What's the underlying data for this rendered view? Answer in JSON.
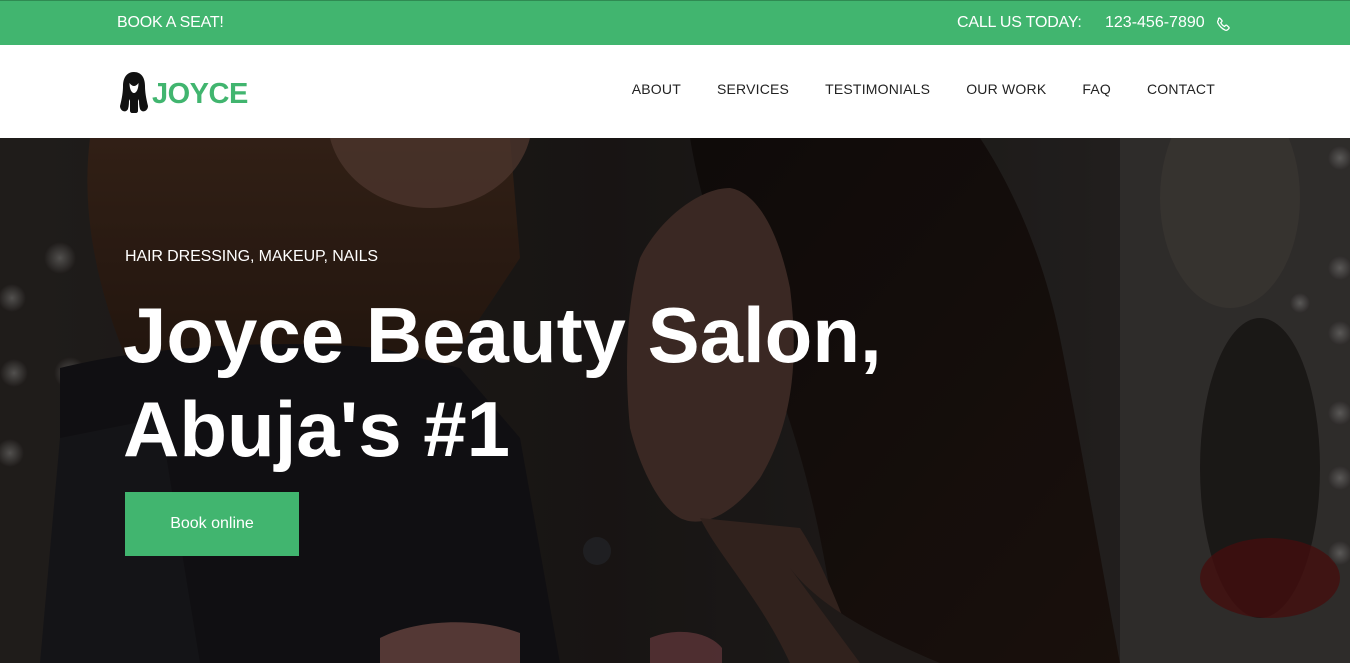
{
  "topbar": {
    "book_label": "BOOK A SEAT!",
    "call_label": "CALL US TODAY:",
    "phone": "123-456-7890",
    "phone_icon": "phone-icon"
  },
  "brand": {
    "name": "JOYCE",
    "logo_icon": "woman-silhouette-icon"
  },
  "nav": {
    "items": [
      {
        "label": "ABOUT"
      },
      {
        "label": "SERVICES"
      },
      {
        "label": "TESTIMONIALS"
      },
      {
        "label": "OUR WORK"
      },
      {
        "label": "FAQ"
      },
      {
        "label": "CONTACT"
      }
    ]
  },
  "hero": {
    "tagline": "HAIR DRESSING, MAKEUP, NAILS",
    "title_line1": "Joyce Beauty Salon,",
    "title_line2": "Abuja's #1",
    "cta_label": "Book online"
  },
  "colors": {
    "accent": "#41b56f",
    "nav_text": "#222222",
    "hero_text": "#ffffff"
  }
}
